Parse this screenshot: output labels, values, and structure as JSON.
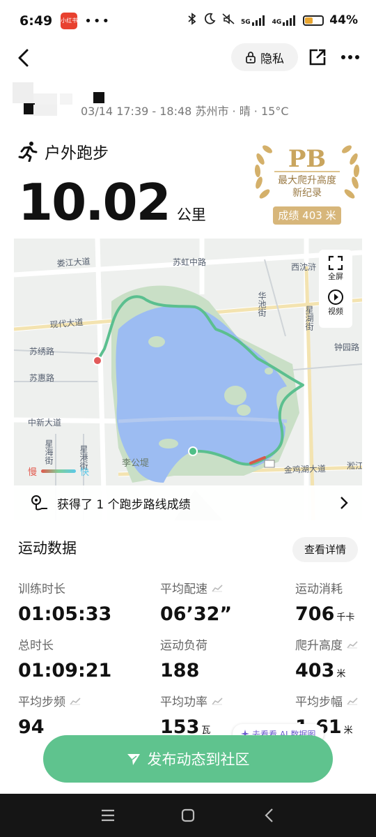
{
  "status_bar": {
    "time": "6:49",
    "app_badge": "小红书",
    "dots": "•••",
    "network_1": "5G",
    "network_2": "4G",
    "battery_percent": "44%",
    "battery_level": 0.44,
    "battery_color": "#e8a530"
  },
  "nav": {
    "privacy_label": "隐私"
  },
  "session": {
    "info": "03/14 17:39 - 18:48 苏州市 · 晴 · 15°C"
  },
  "activity": {
    "type_label": "户外跑步",
    "distance_value": "10.02",
    "distance_unit": "公里"
  },
  "pb_badge": {
    "title": "PB",
    "line1": "最大爬升高度",
    "line2": "新纪录",
    "score": "成绩 403 米",
    "color": "#c9a55e"
  },
  "map": {
    "labels": {
      "songjiang": "娄江大道",
      "suhong": "苏虹中路",
      "xishen": "西沈浒",
      "huachi": "华池街",
      "xinghu": "星湖街",
      "xiandai": "现代大道",
      "zhongji": "钟园路",
      "suxiu": "苏绣路",
      "suhui": "苏惠路",
      "zhongxin": "中新大道",
      "xinghai": "星海街",
      "xinggang": "星港街",
      "ligongdi": "李公堤",
      "jinji": "金鸡湖大道",
      "song": "淞江"
    },
    "fullscreen_label": "全屏",
    "video_label": "视频",
    "legend_slow": "慢",
    "legend_fast": "快",
    "banner_text": "获得了 1 个跑步路线成绩",
    "route_color": "#5bbf8f",
    "water_color": "#9cbcf2"
  },
  "stats": {
    "title": "运动数据",
    "details_label": "查看详情",
    "items": [
      {
        "label": "训练时长",
        "value": "01:05:33",
        "unit": ""
      },
      {
        "label": "平均配速",
        "value": "06’32”",
        "unit": ""
      },
      {
        "label": "运动消耗",
        "value": "706",
        "unit": "千卡"
      },
      {
        "label": "总时长",
        "value": "01:09:21",
        "unit": ""
      },
      {
        "label": "运动负荷",
        "value": "188",
        "unit": ""
      },
      {
        "label": "爬升高度",
        "value": "403",
        "unit": "米"
      },
      {
        "label": "平均步频",
        "value": "94",
        "unit": ""
      },
      {
        "label": "平均功率",
        "value": "153",
        "unit": "瓦"
      },
      {
        "label": "平均步幅",
        "value": "1.61",
        "unit": "米"
      }
    ]
  },
  "ai_hint": {
    "label": "去看看 AI 数据图"
  },
  "publish": {
    "label": "发布动态到社区"
  }
}
